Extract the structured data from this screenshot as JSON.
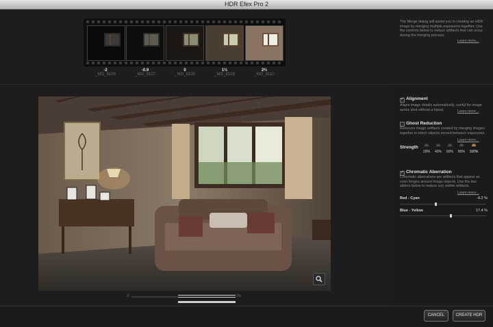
{
  "window": {
    "title": "HDR Efex Pro 2"
  },
  "filmstrip": {
    "exposures": [
      {
        "ev": "-2",
        "file": "_MG_9106"
      },
      {
        "ev": "-0.9",
        "file": "_MG_9107"
      },
      {
        "ev": "0",
        "file": "_MG_9108"
      },
      {
        "ev": "1⅓",
        "file": "_MG_9109"
      },
      {
        "ev": "2⅔",
        "file": "_MG_9110"
      }
    ]
  },
  "intro": {
    "text": "The Merge dialog will assist you in creating an HDR image by merging multiple exposures together. Use the controls below to reduce artifacts that can occur during the merging process.",
    "learn_more": "Learn more..."
  },
  "alignment": {
    "label": "Alignment",
    "checked": true,
    "text": "Aligns image details automatically, useful for image series shot without a tripod.",
    "learn_more": "Learn more..."
  },
  "ghost_reduction": {
    "label": "Ghost Reduction",
    "checked": false,
    "text": "Removes image artifacts created by merging images together in which objects moved between exposures.",
    "learn_more": "Learn more...",
    "strength_label": "Strength",
    "strength_options": [
      "20%",
      "40%",
      "60%",
      "80%",
      "100%"
    ],
    "strength_selected": "100%"
  },
  "chromatic_aberration": {
    "label": "Chromatic Aberration",
    "checked": true,
    "text": "Chromatic aberrations are artifacts that appear as color fringes around image objects. Use the two sliders below to reduce any visible artifacts.",
    "learn_more": "Learn more...",
    "red_cyan": {
      "label": "Red - Cyan",
      "value": "-4.2 %",
      "fraction": 0.41
    },
    "blue_yellow": {
      "label": "Blue - Yellow",
      "value": "17.4 %",
      "fraction": 0.59
    }
  },
  "preview": {
    "zoom_icon": "magnifier-icon",
    "slider_min": "-2",
    "slider_max": "2⅔",
    "slider_fraction": 0.57
  },
  "buttons": {
    "cancel": "CANCEL",
    "create": "CREATE HDR"
  }
}
